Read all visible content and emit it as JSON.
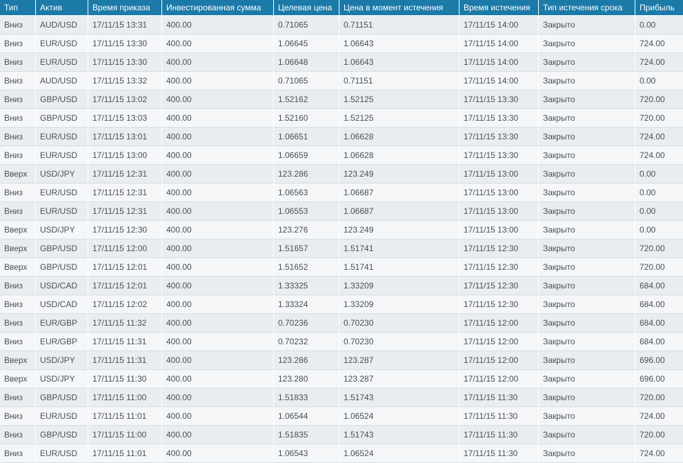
{
  "table": {
    "columns": [
      "Тип",
      "Актив",
      "Время приказа",
      "Инвестированная сумма",
      "Целевая цена",
      "Цена в момент истечения",
      "Время истечения",
      "Тип истечения срока",
      "Прибыль"
    ],
    "rows": [
      [
        "Вниз",
        "AUD/USD",
        "17/11/15 13:31",
        "400.00",
        "0.71065",
        "0.71151",
        "17/11/15 14:00",
        "Закрыто",
        "0.00"
      ],
      [
        "Вниз",
        "EUR/USD",
        "17/11/15 13:30",
        "400.00",
        "1.06645",
        "1.06643",
        "17/11/15 14:00",
        "Закрыто",
        "724.00"
      ],
      [
        "Вниз",
        "EUR/USD",
        "17/11/15 13:30",
        "400.00",
        "1.06648",
        "1.06643",
        "17/11/15 14:00",
        "Закрыто",
        "724.00"
      ],
      [
        "Вниз",
        "AUD/USD",
        "17/11/15 13:32",
        "400.00",
        "0.71065",
        "0.71151",
        "17/11/15 14:00",
        "Закрыто",
        "0.00"
      ],
      [
        "Вниз",
        "GBP/USD",
        "17/11/15 13:02",
        "400.00",
        "1.52162",
        "1.52125",
        "17/11/15 13:30",
        "Закрыто",
        "720.00"
      ],
      [
        "Вниз",
        "GBP/USD",
        "17/11/15 13:03",
        "400.00",
        "1.52160",
        "1.52125",
        "17/11/15 13:30",
        "Закрыто",
        "720.00"
      ],
      [
        "Вниз",
        "EUR/USD",
        "17/11/15 13:01",
        "400.00",
        "1.06651",
        "1.06628",
        "17/11/15 13:30",
        "Закрыто",
        "724.00"
      ],
      [
        "Вниз",
        "EUR/USD",
        "17/11/15 13:00",
        "400.00",
        "1.06659",
        "1.06628",
        "17/11/15 13:30",
        "Закрыто",
        "724.00"
      ],
      [
        "Вверх",
        "USD/JPY",
        "17/11/15 12:31",
        "400.00",
        "123.286",
        "123.249",
        "17/11/15 13:00",
        "Закрыто",
        "0.00"
      ],
      [
        "Вниз",
        "EUR/USD",
        "17/11/15 12:31",
        "400.00",
        "1.06563",
        "1.06687",
        "17/11/15 13:00",
        "Закрыто",
        "0.00"
      ],
      [
        "Вниз",
        "EUR/USD",
        "17/11/15 12:31",
        "400.00",
        "1.06553",
        "1.06687",
        "17/11/15 13:00",
        "Закрыто",
        "0.00"
      ],
      [
        "Вверх",
        "USD/JPY",
        "17/11/15 12:30",
        "400.00",
        "123.276",
        "123.249",
        "17/11/15 13:00",
        "Закрыто",
        "0.00"
      ],
      [
        "Вверх",
        "GBP/USD",
        "17/11/15 12:00",
        "400.00",
        "1.51657",
        "1.51741",
        "17/11/15 12:30",
        "Закрыто",
        "720.00"
      ],
      [
        "Вверх",
        "GBP/USD",
        "17/11/15 12:01",
        "400.00",
        "1.51652",
        "1.51741",
        "17/11/15 12:30",
        "Закрыто",
        "720.00"
      ],
      [
        "Вниз",
        "USD/CAD",
        "17/11/15 12:01",
        "400.00",
        "1.33325",
        "1.33209",
        "17/11/15 12:30",
        "Закрыто",
        "684.00"
      ],
      [
        "Вниз",
        "USD/CAD",
        "17/11/15 12:02",
        "400.00",
        "1.33324",
        "1.33209",
        "17/11/15 12:30",
        "Закрыто",
        "684.00"
      ],
      [
        "Вниз",
        "EUR/GBP",
        "17/11/15 11:32",
        "400.00",
        "0.70236",
        "0.70230",
        "17/11/15 12:00",
        "Закрыто",
        "684.00"
      ],
      [
        "Вниз",
        "EUR/GBP",
        "17/11/15 11:31",
        "400.00",
        "0.70232",
        "0.70230",
        "17/11/15 12:00",
        "Закрыто",
        "684.00"
      ],
      [
        "Вверх",
        "USD/JPY",
        "17/11/15 11:31",
        "400.00",
        "123.286",
        "123.287",
        "17/11/15 12:00",
        "Закрыто",
        "696.00"
      ],
      [
        "Вверх",
        "USD/JPY",
        "17/11/15 11:30",
        "400.00",
        "123.280",
        "123.287",
        "17/11/15 12:00",
        "Закрыто",
        "696.00"
      ],
      [
        "Вниз",
        "GBP/USD",
        "17/11/15 11:00",
        "400.00",
        "1.51833",
        "1.51743",
        "17/11/15 11:30",
        "Закрыто",
        "720.00"
      ],
      [
        "Вниз",
        "EUR/USD",
        "17/11/15 11:01",
        "400.00",
        "1.06544",
        "1.06524",
        "17/11/15 11:30",
        "Закрыто",
        "724.00"
      ],
      [
        "Вниз",
        "GBP/USD",
        "17/11/15 11:00",
        "400.00",
        "1.51835",
        "1.51743",
        "17/11/15 11:30",
        "Закрыто",
        "720.00"
      ],
      [
        "Вниз",
        "EUR/USD",
        "17/11/15 11:01",
        "400.00",
        "1.06543",
        "1.06524",
        "17/11/15 11:30",
        "Закрыто",
        "724.00"
      ]
    ]
  },
  "colors": {
    "header_bg": "#1b7aa8",
    "header_text": "#ffffff",
    "row_odd_bg": "#e9edf0",
    "row_even_bg": "#f4f6f8",
    "cell_text": "#4a4f55"
  }
}
